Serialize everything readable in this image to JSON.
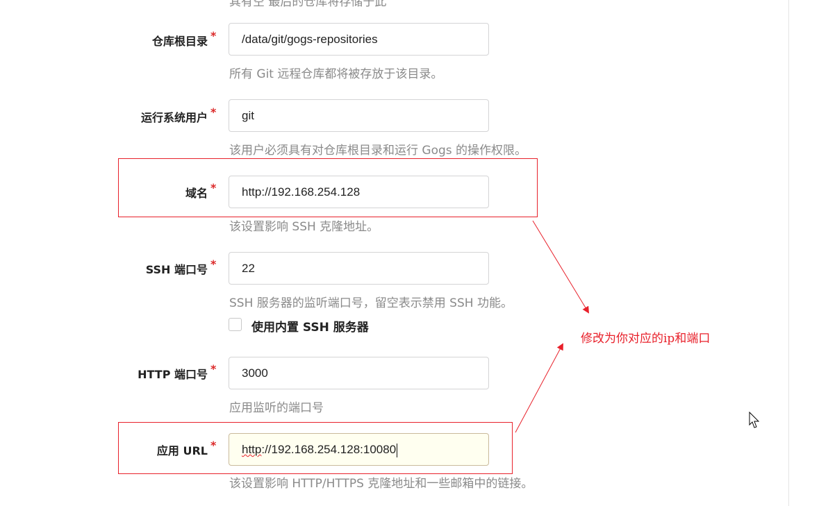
{
  "top_cutoff_text": "其有空 最后的仓库将存储于此",
  "required_mark": "*",
  "fields": [
    {
      "label": "仓库根目录",
      "value": "/data/git/gogs-repositories",
      "help": "所有 Git 远程仓库都将被存放于该目录。"
    },
    {
      "label": "运行系统用户",
      "value": "git",
      "help": "该用户必须具有对仓库根目录和运行 Gogs 的操作权限。"
    },
    {
      "label": "域名",
      "value": "http://192.168.254.128",
      "help": "该设置影响 SSH 克隆地址。"
    },
    {
      "label": "SSH 端口号",
      "value": "22",
      "help": "SSH 服务器的监听端口号，留空表示禁用 SSH 功能。"
    },
    {
      "label": "HTTP 端口号",
      "value": "3000",
      "help": "应用监听的端口号"
    },
    {
      "label": "应用 URL",
      "value_prefix": "http",
      "value_rest": "://192.168.254.128:10080",
      "help": "该设置影响 HTTP/HTTPS 克隆地址和一些邮箱中的链接。"
    }
  ],
  "builtin_ssh": {
    "label": "使用内置 SSH 服务器",
    "checked": false
  },
  "annotation": {
    "text": "修改为你对应的ip和端口",
    "color": "#e8202a"
  },
  "colors": {
    "required": "#db2828",
    "help_text": "#8a8a8a",
    "active_field_bg": "#fffff0"
  }
}
